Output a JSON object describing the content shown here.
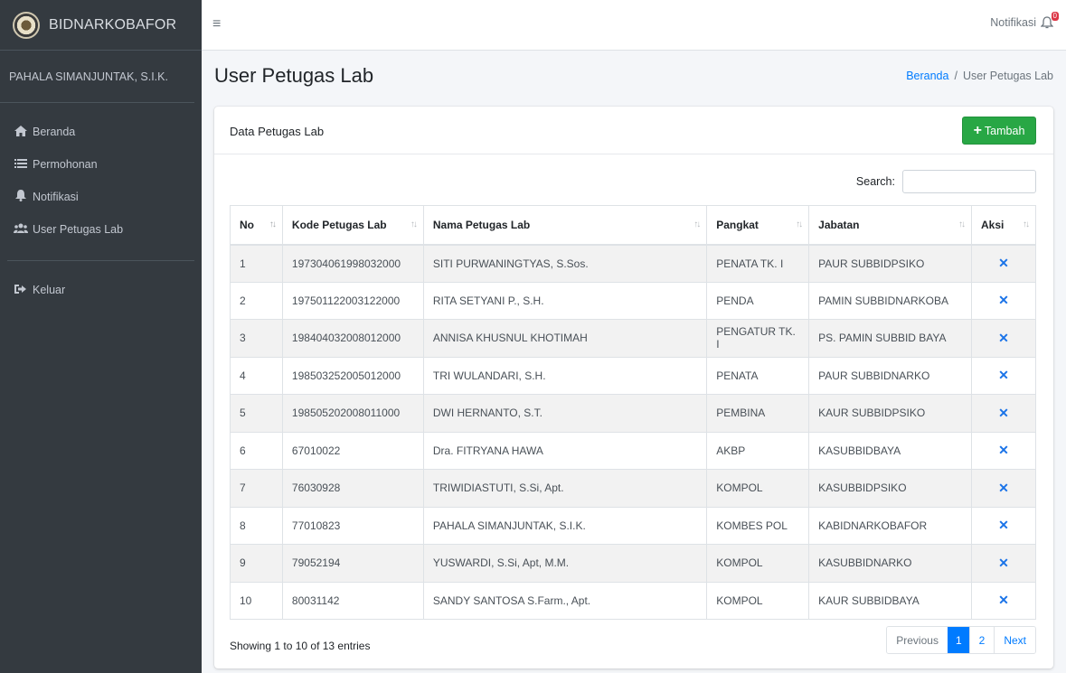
{
  "brand": {
    "name": "BIDNARKOBAFOR"
  },
  "sidebar": {
    "user_name": "PAHALA SIMANJUNTAK, S.I.K.",
    "items": [
      {
        "label": "Beranda",
        "icon": "home-icon"
      },
      {
        "label": "Permohonan",
        "icon": "list-icon"
      },
      {
        "label": "Notifikasi",
        "icon": "bell-icon"
      },
      {
        "label": "User Petugas Lab",
        "icon": "users-icon"
      }
    ],
    "logout": {
      "label": "Keluar",
      "icon": "sign-out-icon"
    }
  },
  "topbar": {
    "notif_label": "Notifikasi",
    "notif_count": "0"
  },
  "page": {
    "title": "User Petugas Lab",
    "breadcrumb": {
      "home": "Beranda",
      "current": "User Petugas Lab",
      "separator": "/"
    }
  },
  "card": {
    "title": "Data Petugas Lab",
    "add_label": "Tambah",
    "search_label": "Search:",
    "search_value": ""
  },
  "table": {
    "headers": {
      "no": "No",
      "kode": "Kode Petugas Lab",
      "nama": "Nama Petugas Lab",
      "pangkat": "Pangkat",
      "jabatan": "Jabatan",
      "aksi": "Aksi"
    },
    "rows": [
      {
        "no": "1",
        "kode": "197304061998032000",
        "nama": "SITI PURWANINGTYAS, S.Sos.",
        "pangkat": "PENATA TK. I",
        "jabatan": "PAUR SUBBIDPSIKO"
      },
      {
        "no": "2",
        "kode": "197501122003122000",
        "nama": "RITA SETYANI P., S.H.",
        "pangkat": "PENDA",
        "jabatan": "PAMIN SUBBIDNARKOBA"
      },
      {
        "no": "3",
        "kode": "198404032008012000",
        "nama": "ANNISA KHUSNUL KHOTIMAH",
        "pangkat": "PENGATUR TK. I",
        "jabatan": "PS. PAMIN SUBBID BAYA"
      },
      {
        "no": "4",
        "kode": "198503252005012000",
        "nama": "TRI WULANDARI, S.H.",
        "pangkat": "PENATA",
        "jabatan": "PAUR SUBBIDNARKO"
      },
      {
        "no": "5",
        "kode": "198505202008011000",
        "nama": "DWI HERNANTO, S.T.",
        "pangkat": "PEMBINA",
        "jabatan": "KAUR SUBBIDPSIKO"
      },
      {
        "no": "6",
        "kode": "67010022",
        "nama": "Dra. FITRYANA HAWA",
        "pangkat": "AKBP",
        "jabatan": "KASUBBIDBAYA"
      },
      {
        "no": "7",
        "kode": "76030928",
        "nama": "TRIWIDIASTUTI, S.Si, Apt.",
        "pangkat": "KOMPOL",
        "jabatan": "KASUBBIDPSIKO"
      },
      {
        "no": "8",
        "kode": "77010823",
        "nama": "PAHALA SIMANJUNTAK, S.I.K.",
        "pangkat": "KOMBES POL",
        "jabatan": "KABIDNARKOBAFOR"
      },
      {
        "no": "9",
        "kode": "79052194",
        "nama": "YUSWARDI, S.Si, Apt, M.M.",
        "pangkat": "KOMPOL",
        "jabatan": "KASUBBIDNARKO"
      },
      {
        "no": "10",
        "kode": "80031142",
        "nama": "SANDY SANTOSA S.Farm., Apt.",
        "pangkat": "KOMPOL",
        "jabatan": "KAUR SUBBIDBAYA"
      }
    ],
    "delete_icon": "close-icon"
  },
  "footer": {
    "info": "Showing 1 to 10 of 13 entries",
    "pagination": {
      "previous": "Previous",
      "pages": [
        "1",
        "2"
      ],
      "active": "1",
      "next": "Next"
    }
  },
  "colors": {
    "sidebar": "#343a40",
    "primary": "#007bff",
    "success": "#28a745",
    "danger": "#dc3545"
  }
}
